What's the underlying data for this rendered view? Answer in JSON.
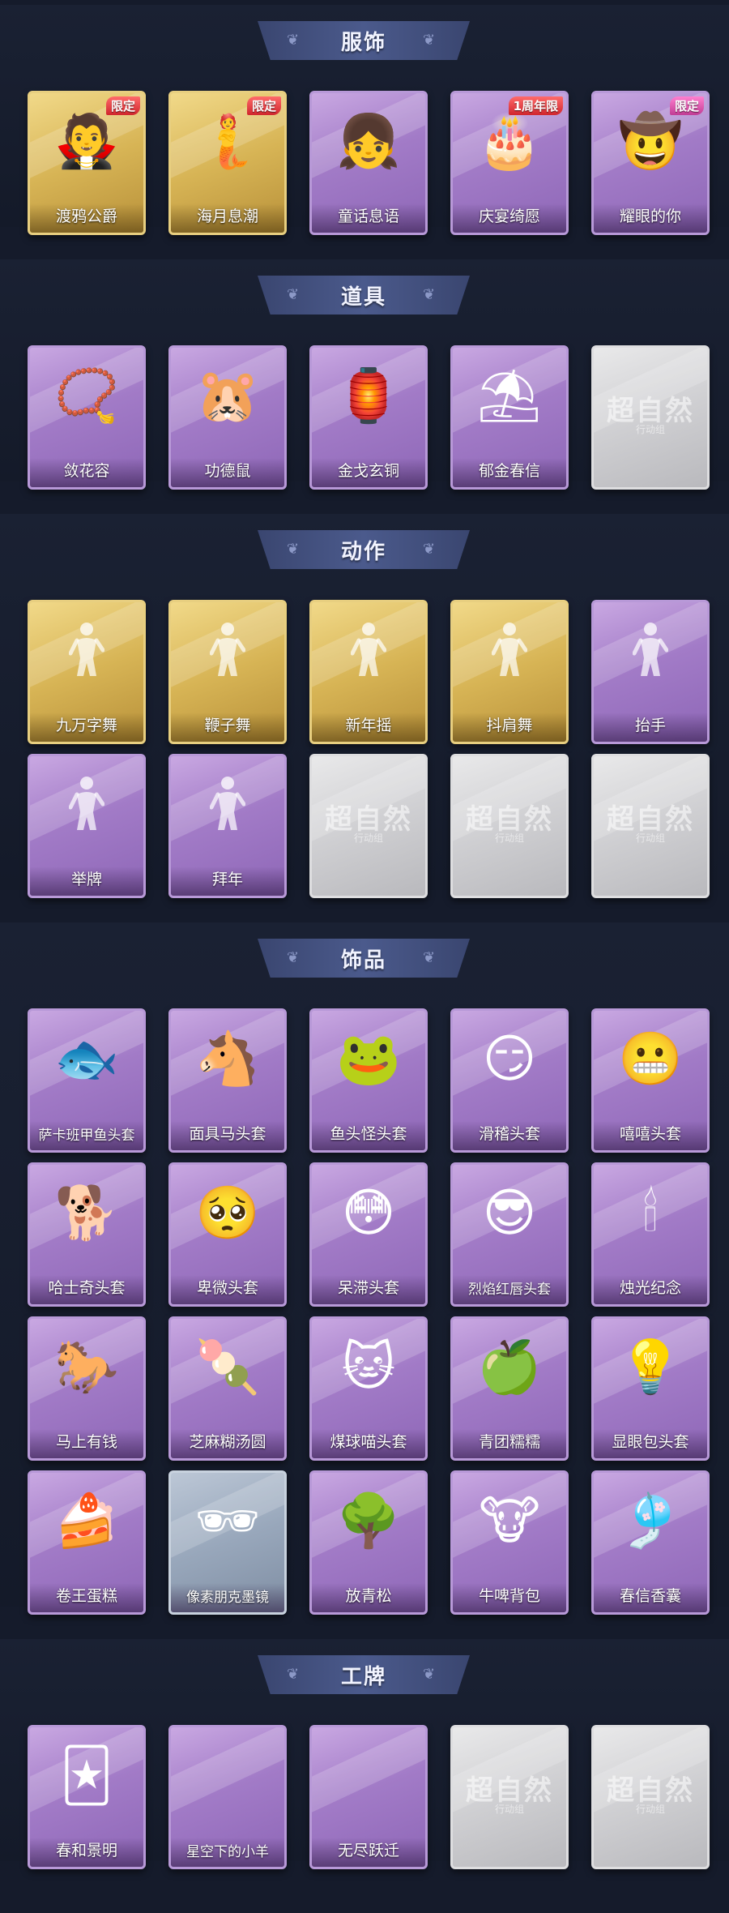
{
  "colors": {
    "background": "#151b2b",
    "banner": "#4b5a8c",
    "card_purple": "#a27bc7",
    "card_gold": "#d7b455",
    "card_silver": "#cfcfd2",
    "badge_red": "#d0262d"
  },
  "sections": [
    {
      "title": "服饰",
      "cards": [
        {
          "label": "渡鸦公爵",
          "rarity": "gold",
          "badge": "限定",
          "icon": "duke-portrait-icon",
          "glyph": "🧛"
        },
        {
          "label": "海月息潮",
          "rarity": "gold",
          "badge": "限定",
          "icon": "mermaid-portrait-icon",
          "glyph": "🧜"
        },
        {
          "label": "童话息语",
          "rarity": "purple",
          "badge": "",
          "icon": "fairytale-girl-icon",
          "glyph": "👧"
        },
        {
          "label": "庆宴绮愿",
          "rarity": "purple",
          "badge": "1周年限",
          "icon": "birthday-cake-icon",
          "glyph": "🎂"
        },
        {
          "label": "耀眼的你",
          "rarity": "purple",
          "badge": "限定",
          "icon": "cowgirl-portrait-icon",
          "glyph": "🤠"
        }
      ]
    },
    {
      "title": "道具",
      "cards": [
        {
          "label": "敛花容",
          "rarity": "purple",
          "badge": "",
          "icon": "flower-chain-icon",
          "glyph": "📿"
        },
        {
          "label": "功德鼠",
          "rarity": "purple",
          "badge": "",
          "icon": "merit-mouse-icon",
          "glyph": "🐹"
        },
        {
          "label": "金戈玄铜",
          "rarity": "purple",
          "badge": "",
          "icon": "bronze-lantern-icon",
          "glyph": "🏮"
        },
        {
          "label": "郁金春信",
          "rarity": "purple",
          "badge": "",
          "icon": "paper-umbrella-icon",
          "glyph": "⛱"
        },
        {
          "label": "",
          "rarity": "silver",
          "badge": "",
          "icon": "placeholder-watermark-icon",
          "glyph": ""
        }
      ]
    },
    {
      "title": "动作",
      "cards": [
        {
          "label": "九万字舞",
          "rarity": "gold",
          "badge": "",
          "icon": "dance-pose-icon",
          "glyph": ""
        },
        {
          "label": "鞭子舞",
          "rarity": "gold",
          "badge": "",
          "icon": "dance-pose-icon",
          "glyph": ""
        },
        {
          "label": "新年摇",
          "rarity": "gold",
          "badge": "",
          "icon": "dance-pose-icon",
          "glyph": ""
        },
        {
          "label": "抖肩舞",
          "rarity": "gold",
          "badge": "",
          "icon": "dance-pose-icon",
          "glyph": ""
        },
        {
          "label": "抬手",
          "rarity": "purple",
          "badge": "",
          "icon": "raise-hand-pose-icon",
          "glyph": ""
        },
        {
          "label": "举牌",
          "rarity": "purple",
          "badge": "",
          "icon": "hold-sign-pose-icon",
          "glyph": ""
        },
        {
          "label": "拜年",
          "rarity": "purple",
          "badge": "",
          "icon": "greeting-pose-icon",
          "glyph": ""
        },
        {
          "label": "",
          "rarity": "silver",
          "badge": "",
          "icon": "placeholder-watermark-icon",
          "glyph": ""
        },
        {
          "label": "",
          "rarity": "silver",
          "badge": "",
          "icon": "placeholder-watermark-icon",
          "glyph": ""
        },
        {
          "label": "",
          "rarity": "silver",
          "badge": "",
          "icon": "placeholder-watermark-icon",
          "glyph": ""
        }
      ]
    },
    {
      "title": "饰品",
      "cards": [
        {
          "label": "萨卡班甲鱼头套",
          "rarity": "purple",
          "badge": "",
          "icon": "fish-mask-icon",
          "glyph": "🐟"
        },
        {
          "label": "面具马头套",
          "rarity": "purple",
          "badge": "",
          "icon": "horse-mask-icon",
          "glyph": "🐴"
        },
        {
          "label": "鱼头怪头套",
          "rarity": "purple",
          "badge": "",
          "icon": "fishhead-mask-icon",
          "glyph": "🐸"
        },
        {
          "label": "滑稽头套",
          "rarity": "purple",
          "badge": "",
          "icon": "smirk-face-icon",
          "glyph": "😏"
        },
        {
          "label": "嘻嘻头套",
          "rarity": "purple",
          "badge": "",
          "icon": "grin-face-icon",
          "glyph": "😬"
        },
        {
          "label": "哈士奇头套",
          "rarity": "purple",
          "badge": "",
          "icon": "husky-mask-icon",
          "glyph": "🐕"
        },
        {
          "label": "卑微头套",
          "rarity": "purple",
          "badge": "",
          "icon": "humble-face-icon",
          "glyph": "🥺"
        },
        {
          "label": "呆滞头套",
          "rarity": "purple",
          "badge": "",
          "icon": "dazed-face-icon",
          "glyph": "😳"
        },
        {
          "label": "烈焰红唇头套",
          "rarity": "purple",
          "badge": "",
          "icon": "pikachu-mask-icon",
          "glyph": "😎"
        },
        {
          "label": "烛光纪念",
          "rarity": "purple",
          "badge": "",
          "icon": "candle-icon",
          "glyph": "🕯"
        },
        {
          "label": "马上有钱",
          "rarity": "purple",
          "badge": "",
          "icon": "red-horse-icon",
          "glyph": "🐎"
        },
        {
          "label": "芝麻糊汤圆",
          "rarity": "purple",
          "badge": "",
          "icon": "dumpling-icon",
          "glyph": "🍡"
        },
        {
          "label": "煤球喵头套",
          "rarity": "purple",
          "badge": "",
          "icon": "cat-mask-icon",
          "glyph": "🐱"
        },
        {
          "label": "青团糯糯",
          "rarity": "purple",
          "badge": "",
          "icon": "green-rice-ball-icon",
          "glyph": "🍏"
        },
        {
          "label": "显眼包头套",
          "rarity": "purple",
          "badge": "",
          "icon": "crowned-bulb-icon",
          "glyph": "💡"
        },
        {
          "label": "卷王蛋糕",
          "rarity": "purple",
          "badge": "",
          "icon": "roll-cake-icon",
          "glyph": "🍰"
        },
        {
          "label": "像素朋克墨镜",
          "rarity": "blue",
          "badge": "",
          "icon": "pixel-sunglasses-icon",
          "glyph": "🕶"
        },
        {
          "label": "放青松",
          "rarity": "purple",
          "badge": "",
          "icon": "bonsai-icon",
          "glyph": "🌳"
        },
        {
          "label": "牛啤背包",
          "rarity": "purple",
          "badge": "",
          "icon": "cow-backpack-icon",
          "glyph": "🐮"
        },
        {
          "label": "春信香囊",
          "rarity": "purple",
          "badge": "",
          "icon": "sachet-icon",
          "glyph": "🎐"
        }
      ]
    },
    {
      "title": "工牌",
      "cards": [
        {
          "label": "春和景明",
          "rarity": "purple",
          "badge": "",
          "icon": "gold-card-icon",
          "glyph": "🃏"
        },
        {
          "label": "星空下的小羊",
          "rarity": "purple",
          "badge": "",
          "icon": "",
          "glyph": ""
        },
        {
          "label": "无尽跃迁",
          "rarity": "purple",
          "badge": "",
          "icon": "",
          "glyph": ""
        },
        {
          "label": "",
          "rarity": "silver",
          "badge": "",
          "icon": "placeholder-watermark-icon",
          "glyph": ""
        },
        {
          "label": "",
          "rarity": "silver",
          "badge": "",
          "icon": "placeholder-watermark-icon",
          "glyph": ""
        }
      ]
    }
  ],
  "watermark": {
    "main": "超自然",
    "sub": "行动组"
  }
}
